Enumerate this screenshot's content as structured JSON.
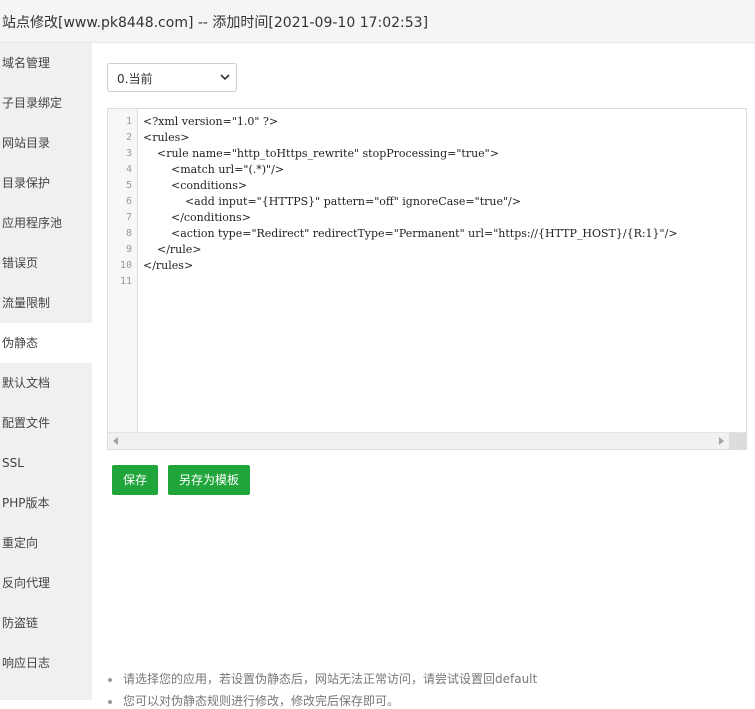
{
  "window": {
    "title": "站点修改[www.pk8448.com] -- 添加时间[2021-09-10 17:02:53]"
  },
  "sidebar": {
    "items": [
      {
        "label": "域名管理"
      },
      {
        "label": "子目录绑定"
      },
      {
        "label": "网站目录"
      },
      {
        "label": "目录保护"
      },
      {
        "label": "应用程序池"
      },
      {
        "label": "错误页"
      },
      {
        "label": "流量限制"
      },
      {
        "label": "伪静态",
        "active": true
      },
      {
        "label": "默认文档"
      },
      {
        "label": "配置文件"
      },
      {
        "label": "SSL"
      },
      {
        "label": "PHP版本"
      },
      {
        "label": "重定向"
      },
      {
        "label": "反向代理"
      },
      {
        "label": "防盗链"
      },
      {
        "label": "响应日志"
      }
    ]
  },
  "rewrite_select": {
    "selected": "0.当前"
  },
  "editor": {
    "line_numbers": [
      "1",
      "2",
      "3",
      "4",
      "5",
      "6",
      "7",
      "8",
      "9",
      "10",
      "11"
    ],
    "lines": [
      "<?xml version=\"1.0\" ?>",
      "<rules>",
      "    <rule name=\"http_toHttps_rewrite\" stopProcessing=\"true\">",
      "        <match url=\"(.*)\"/>",
      "        <conditions>",
      "            <add input=\"{HTTPS}\" pattern=\"off\" ignoreCase=\"true\"/>",
      "        </conditions>",
      "        <action type=\"Redirect\" redirectType=\"Permanent\" url=\"https://{HTTP_HOST}/{R:1}\"/>",
      "    </rule>",
      "</rules>",
      ""
    ]
  },
  "buttons": {
    "save": "保存",
    "save_as_template": "另存为模板"
  },
  "tips": [
    "请选择您的应用，若设置伪静态后，网站无法正常访问，请尝试设置回default",
    "您可以对伪静态规则进行修改，修改完后保存即可。"
  ],
  "colors": {
    "primary_green": "#20a53a",
    "sidebar_bg": "#f0f0f0",
    "title_bg": "#f5f5f5"
  }
}
